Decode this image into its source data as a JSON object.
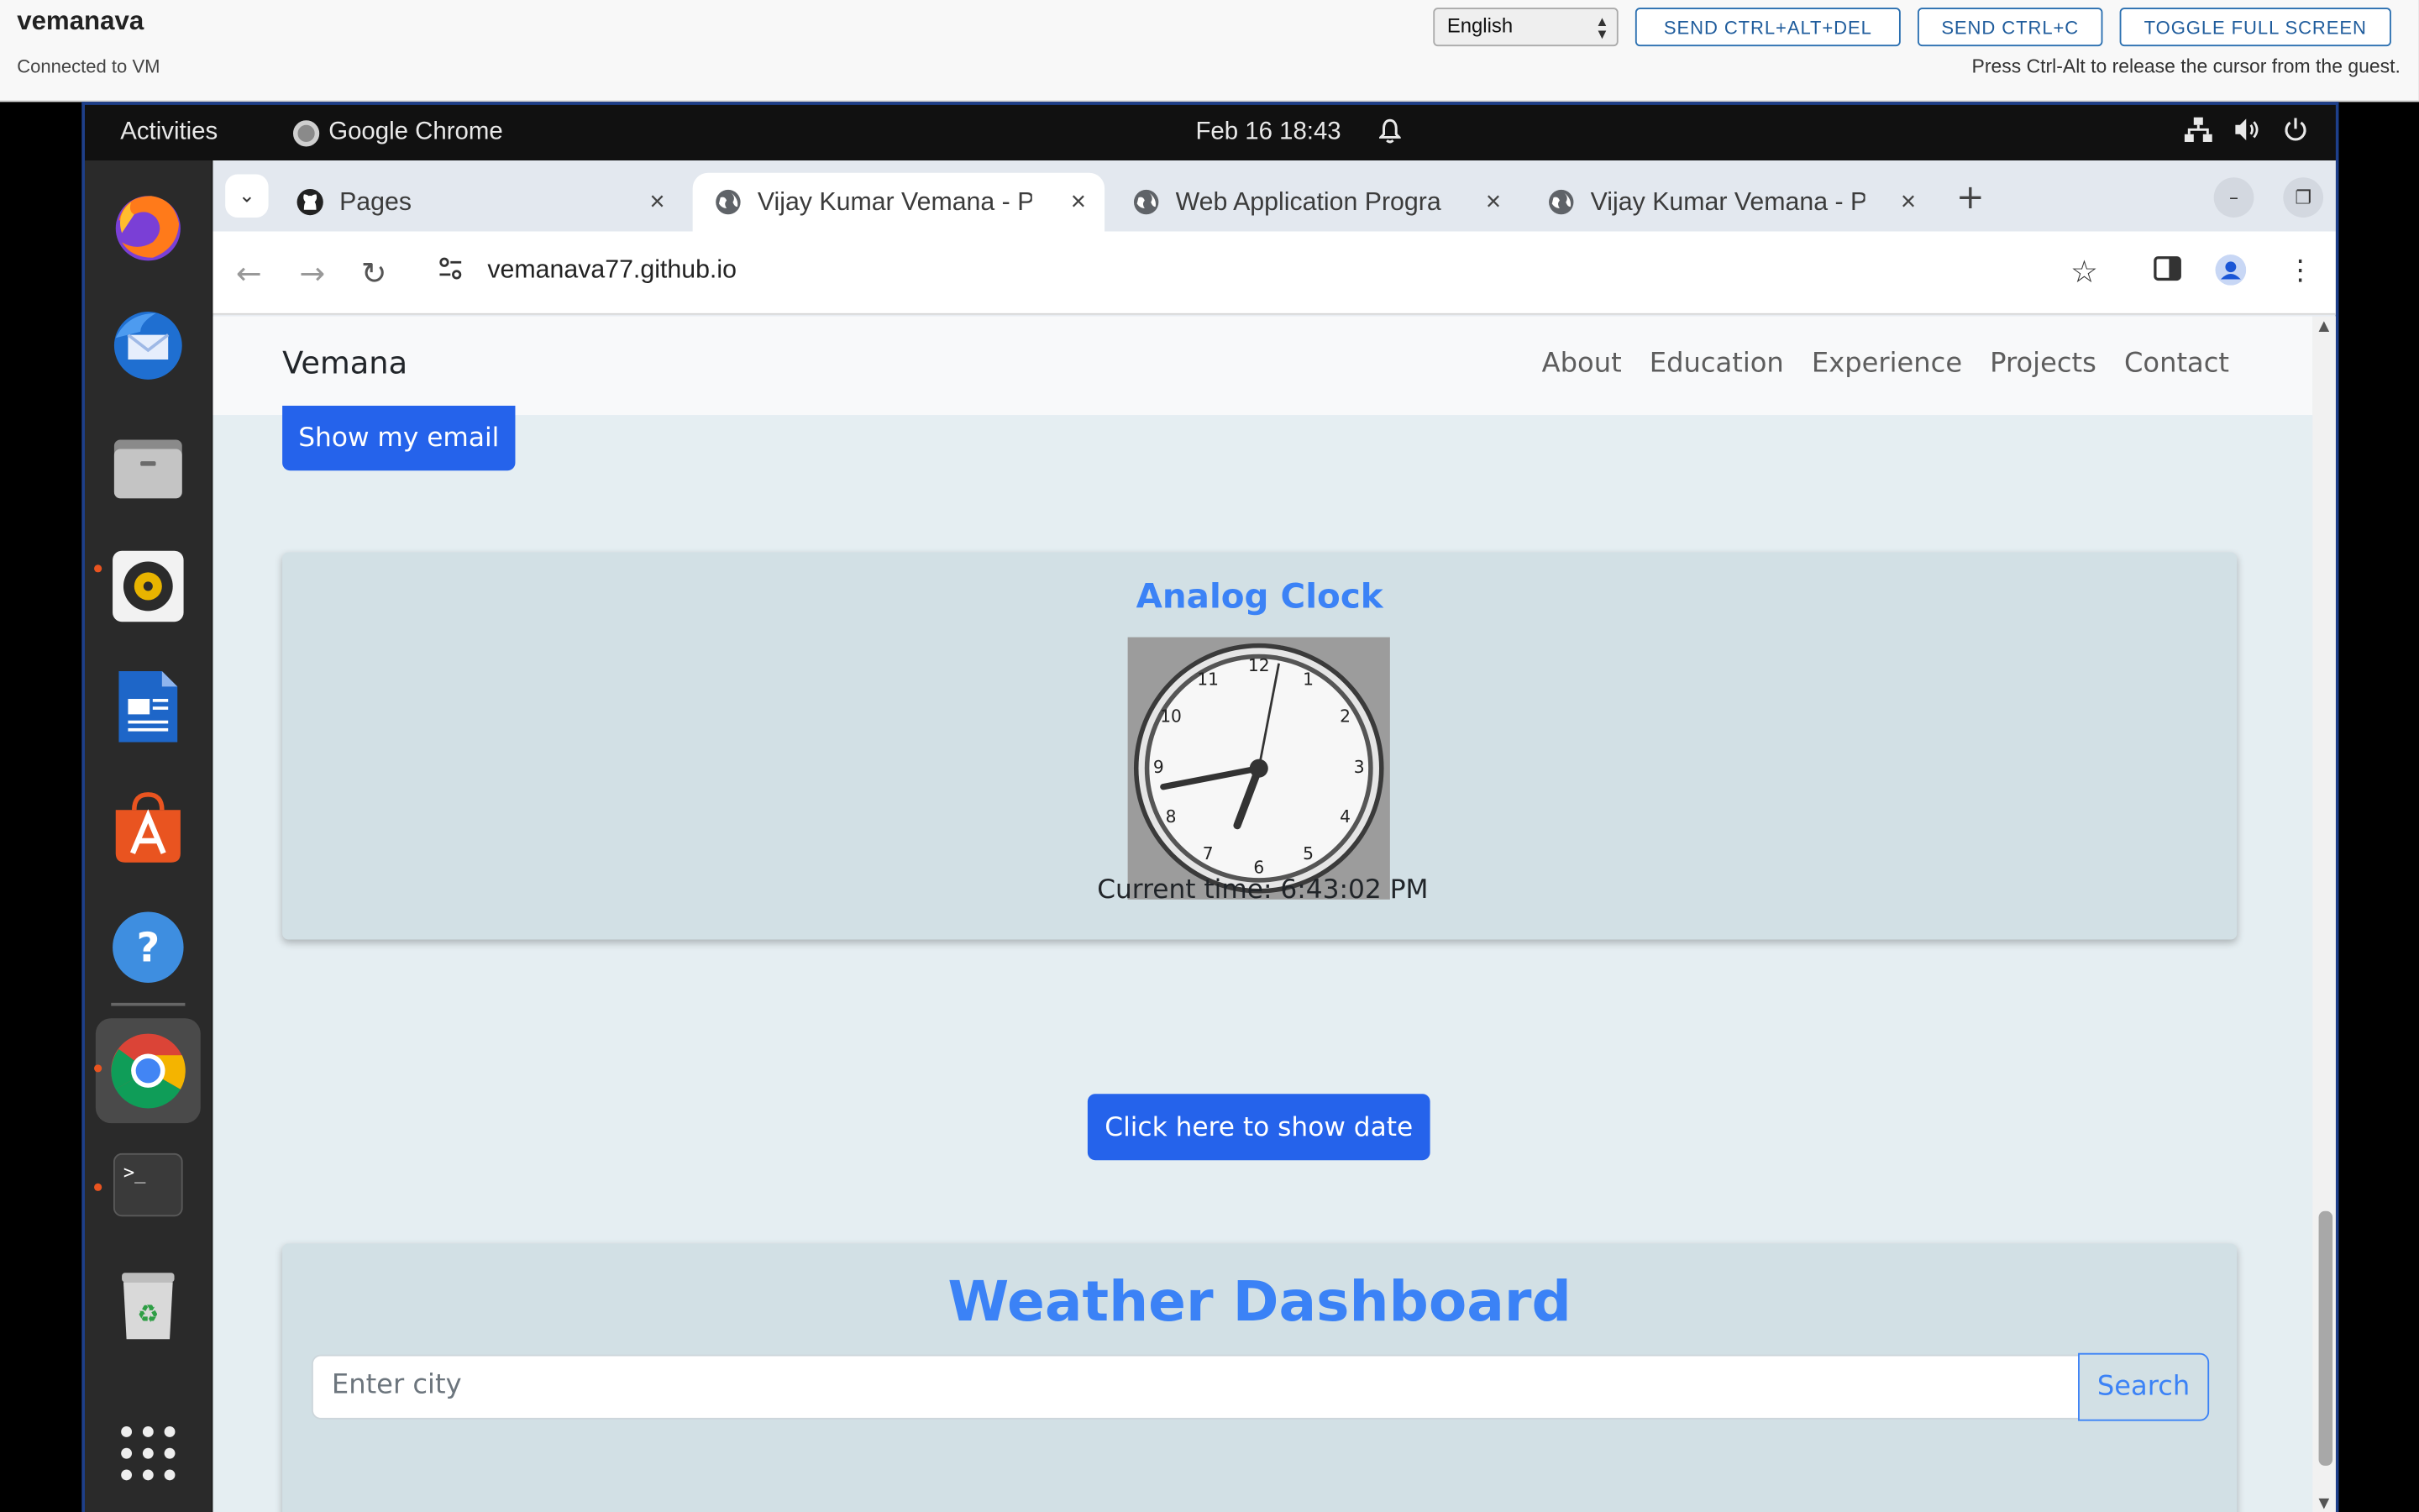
{
  "vm": {
    "name": "vemanava",
    "status": "Connected to VM",
    "language": "English",
    "buttons": {
      "ctrl_alt_del": "SEND CTRL+ALT+DEL",
      "ctrl_c": "SEND CTRL+C",
      "fullscreen": "TOGGLE FULL SCREEN"
    },
    "hint": "Press Ctrl-Alt to release the cursor from the guest."
  },
  "gnome": {
    "activities": "Activities",
    "app_name": "Google Chrome",
    "datetime": "Feb 16  18:43"
  },
  "dock": {
    "items": [
      "firefox-icon",
      "thunderbird-icon",
      "files-icon",
      "rhythmbox-icon",
      "writer-icon",
      "app-center-icon",
      "help-icon",
      "chrome-icon",
      "terminal-icon",
      "trash-icon",
      "app-grid-icon"
    ]
  },
  "chrome": {
    "tabs": [
      {
        "title": "Pages",
        "icon": "github-icon"
      },
      {
        "title": "Vijay Kumar Vemana - Pr",
        "icon": "globe-icon"
      },
      {
        "title": "Web Application Progra",
        "icon": "globe-icon"
      },
      {
        "title": "Vijay Kumar Vemana - Pr",
        "icon": "globe-icon"
      }
    ],
    "url": "vemanava77.github.io"
  },
  "page": {
    "brand": "Vemana",
    "nav": [
      "About",
      "Education",
      "Experience",
      "Projects",
      "Contact"
    ],
    "show_email_label": "Show my email",
    "clock_title": "Analog Clock",
    "clock_numbers": [
      "12",
      "1",
      "2",
      "3",
      "4",
      "5",
      "6",
      "7",
      "8",
      "9",
      "10",
      "11"
    ],
    "current_time": "Current time: 6:43:02 PM",
    "show_date_label": "Click here to show date",
    "weather_title": "Weather Dashboard",
    "city_placeholder": "Enter city",
    "search_label": "Search"
  },
  "colors": {
    "primary_button": "#2563eb",
    "title_blue": "#3b82f6",
    "page_bg": "#e5eef2",
    "card_bg": "#d2e0e5"
  }
}
